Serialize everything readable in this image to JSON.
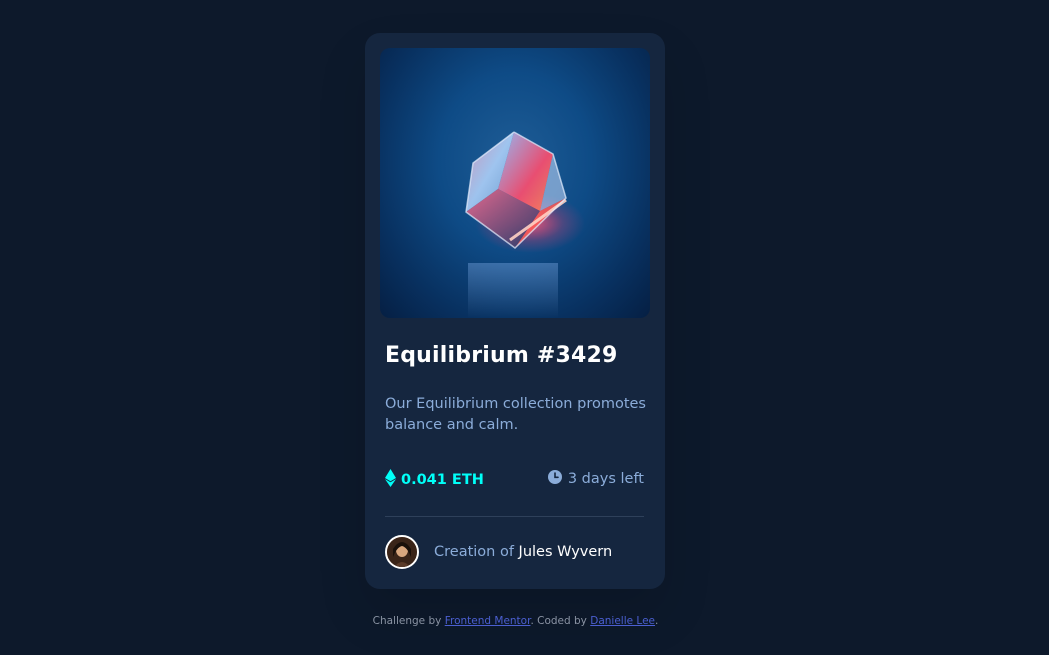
{
  "card": {
    "image_alt": "Equilibrium cube",
    "title": "Equilibrium #3429",
    "description": "Our Equilibrium collection promotes balance and calm.",
    "price": "0.041 ETH",
    "time_left": "3 days left",
    "creator_prefix": "Creation of",
    "creator_name": "Jules Wyvern",
    "icons": {
      "price": "ethereum-icon",
      "time": "clock-icon"
    }
  },
  "attribution": {
    "prefix": "Challenge by",
    "link1": "Frontend Mentor",
    "middle": ". Coded by",
    "link2": "Danielle Lee",
    "suffix": "."
  },
  "colors": {
    "page_bg": "#0d192b",
    "card_bg": "#15263f",
    "cyan": "#00fff8",
    "soft_blue": "#8bacd9",
    "white": "#ffffff"
  }
}
